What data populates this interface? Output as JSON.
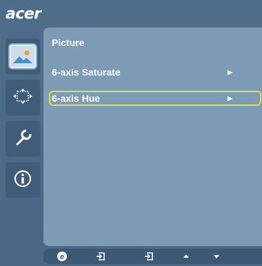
{
  "brand": {
    "logo_text": "acer"
  },
  "sidebar": {
    "items": [
      {
        "name": "picture",
        "icon": "picture-icon",
        "active": true
      },
      {
        "name": "display",
        "icon": "display-position-icon",
        "active": false
      },
      {
        "name": "settings",
        "icon": "wrench-settings-icon",
        "active": false
      },
      {
        "name": "information",
        "icon": "info-icon",
        "active": false
      }
    ]
  },
  "panel": {
    "title": "Picture",
    "items": [
      {
        "label": "6-axis Saturate",
        "selected": false
      },
      {
        "label": "6-axis Hue",
        "selected": true
      }
    ]
  },
  "bottom_bar": {
    "icons": [
      "e-key-icon",
      "exit-icon",
      "enter-icon",
      "up-arrow-icon",
      "down-arrow-icon"
    ]
  },
  "colors": {
    "background": "#4e6d8a",
    "panel": "#7d9bb5",
    "selection_border": "#e8e13a",
    "bottom_bar": "#3b5875"
  }
}
